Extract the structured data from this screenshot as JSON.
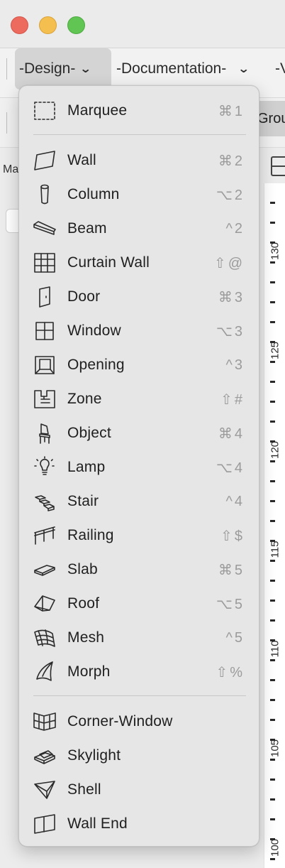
{
  "toolbar": {
    "dropdowns": [
      {
        "label": "-Design-",
        "active": true
      },
      {
        "label": "-Documentation-",
        "active": false
      },
      {
        "label": "-V",
        "active": false
      }
    ],
    "tab_partial": "Grou",
    "left_label": "Ma"
  },
  "ruler": {
    "labels": [
      "130",
      "125",
      "120",
      "115",
      "110",
      "105",
      "100"
    ]
  },
  "menu": {
    "items": [
      {
        "label": "Marquee",
        "shortcut": "⌘1",
        "icon": "marquee-icon"
      },
      {
        "label": "Wall",
        "shortcut": "⌘2",
        "icon": "wall-icon"
      },
      {
        "label": "Column",
        "shortcut": "⌥2",
        "icon": "column-icon"
      },
      {
        "label": "Beam",
        "shortcut": "^2",
        "icon": "beam-icon"
      },
      {
        "label": "Curtain Wall",
        "shortcut": "⇧@",
        "icon": "curtain-wall-icon"
      },
      {
        "label": "Door",
        "shortcut": "⌘3",
        "icon": "door-icon"
      },
      {
        "label": "Window",
        "shortcut": "⌥3",
        "icon": "window-icon"
      },
      {
        "label": "Opening",
        "shortcut": "^3",
        "icon": "opening-icon"
      },
      {
        "label": "Zone",
        "shortcut": "⇧#",
        "icon": "zone-icon"
      },
      {
        "label": "Object",
        "shortcut": "⌘4",
        "icon": "object-icon"
      },
      {
        "label": "Lamp",
        "shortcut": "⌥4",
        "icon": "lamp-icon"
      },
      {
        "label": "Stair",
        "shortcut": "^4",
        "icon": "stair-icon"
      },
      {
        "label": "Railing",
        "shortcut": "⇧$",
        "icon": "railing-icon"
      },
      {
        "label": "Slab",
        "shortcut": "⌘5",
        "icon": "slab-icon"
      },
      {
        "label": "Roof",
        "shortcut": "⌥5",
        "icon": "roof-icon"
      },
      {
        "label": "Mesh",
        "shortcut": "^5",
        "icon": "mesh-icon"
      },
      {
        "label": "Morph",
        "shortcut": "⇧%",
        "icon": "morph-icon"
      },
      {
        "label": "Corner-Window",
        "shortcut": "",
        "icon": "corner-window-icon"
      },
      {
        "label": "Skylight",
        "shortcut": "",
        "icon": "skylight-icon"
      },
      {
        "label": "Shell",
        "shortcut": "",
        "icon": "shell-icon"
      },
      {
        "label": "Wall End",
        "shortcut": "",
        "icon": "wall-end-icon"
      }
    ]
  }
}
